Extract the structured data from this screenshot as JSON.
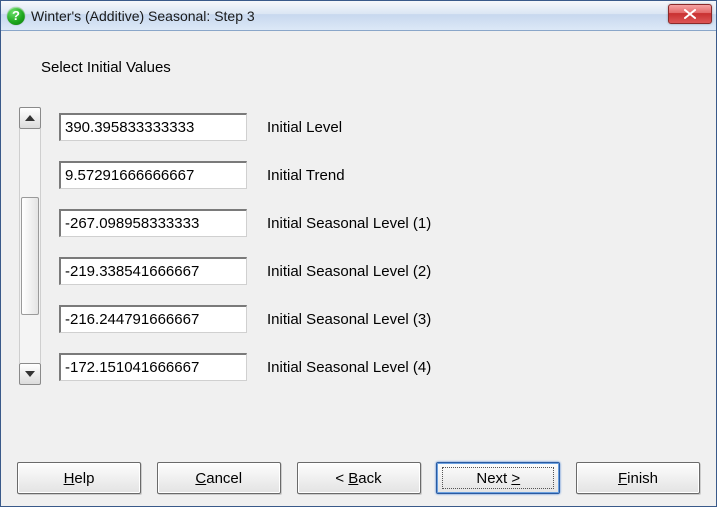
{
  "window": {
    "title": "Winter's (Additive) Seasonal: Step 3"
  },
  "section_label": "Select Initial Values",
  "rows": [
    {
      "value": "390.395833333333",
      "label": "Initial Level"
    },
    {
      "value": "9.57291666666667",
      "label": "Initial Trend"
    },
    {
      "value": "-267.098958333333",
      "label": "Initial Seasonal Level (1)"
    },
    {
      "value": "-219.338541666667",
      "label": "Initial Seasonal Level (2)"
    },
    {
      "value": "-216.244791666667",
      "label": "Initial Seasonal Level (3)"
    },
    {
      "value": "-172.151041666667",
      "label": "Initial Seasonal Level (4)"
    }
  ],
  "buttons": {
    "help": {
      "mnemonic": "H",
      "rest": "elp"
    },
    "cancel": {
      "mnemonic": "C",
      "rest": "ancel"
    },
    "back": {
      "prefix": "< ",
      "mnemonic": "B",
      "rest": "ack"
    },
    "next": {
      "pre": "Next ",
      "mnemonic": ">",
      "rest": ""
    },
    "finish": {
      "mnemonic": "F",
      "rest": "inish"
    }
  }
}
